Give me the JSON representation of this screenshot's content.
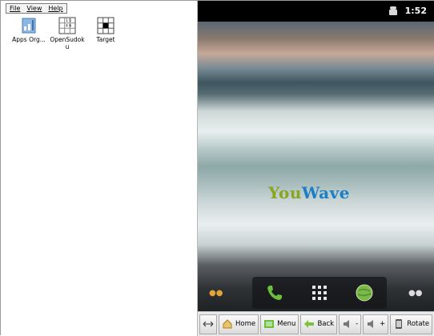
{
  "menu": {
    "file": "File",
    "view": "View",
    "help": "Help"
  },
  "apps": [
    {
      "icon": "apps-organizer-icon",
      "label": "Apps Org..."
    },
    {
      "icon": "opensudoku-icon",
      "label": "OpenSudoku"
    },
    {
      "icon": "target-icon",
      "label": "Target"
    }
  ],
  "status": {
    "time": "1:52"
  },
  "brand": {
    "you": "You",
    "wave": "Wave"
  },
  "toolbar": {
    "home": "Home",
    "menu": "Menu",
    "back": "Back",
    "vol_down": "-",
    "vol_up": "+",
    "rotate": "Rotate"
  },
  "colors": {
    "brand_green": "#8aa51f",
    "brand_blue": "#1a7fc4",
    "clock": "#ffffff"
  }
}
